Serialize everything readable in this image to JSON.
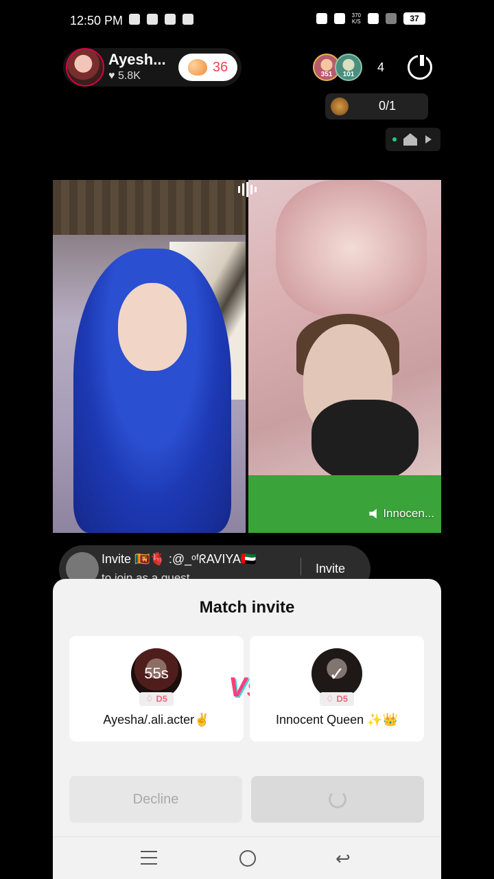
{
  "status_bar": {
    "time": "12:50 PM",
    "speed": "370\nK/S",
    "battery": "37"
  },
  "host": {
    "name": "Ayesh...",
    "likes": "♥ 5.8K",
    "like_count": "36"
  },
  "viewers": {
    "badge_1": "351",
    "badge_2": "101",
    "count": "4"
  },
  "rank": {
    "value": "0/1"
  },
  "video": {
    "right_name": "Innocen..."
  },
  "invite_banner": {
    "text": "Invite 🇱🇰🫀 :@_ᵒᶠᖇAVIYA🇦🇪",
    "subtext": "to join as a guest",
    "button": "Invite"
  },
  "match_invite": {
    "title": "Match invite",
    "left": {
      "timer": "55s",
      "tier": "D5",
      "name": "Ayesha/.ali.acter✌️"
    },
    "right": {
      "tier": "D5",
      "name": "Innocent Queen ✨👑"
    },
    "vs": "Vs",
    "decline_label": "Decline"
  },
  "colors": {
    "accent_pink": "#ff3e7a",
    "accent_cyan": "#3ad7e6",
    "live_green": "#1fd17a"
  },
  "icons": [
    "power-icon",
    "home-icon",
    "play-icon",
    "speaker-icon",
    "menu-icon",
    "circle-home-icon",
    "back-icon",
    "heart-icon"
  ]
}
